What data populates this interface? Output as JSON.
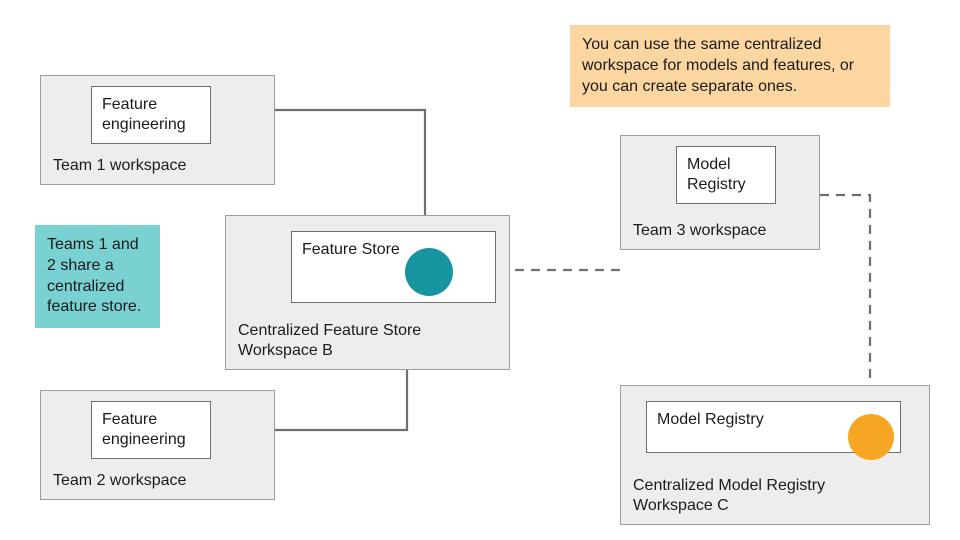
{
  "boxes": {
    "team1": {
      "label": "Team 1 workspace",
      "inner": "Feature\nengineering"
    },
    "team2": {
      "label": "Team 2 workspace",
      "inner": "Feature\nengineering"
    },
    "featureStore": {
      "label": "Centralized Feature Store\nWorkspace B",
      "inner": "Feature Store"
    },
    "team3": {
      "label": "Team 3 workspace",
      "inner": "Model\nRegistry"
    },
    "modelRegistry": {
      "label": "Centralized Model Registry\nWorkspace C",
      "inner": "Model Registry"
    }
  },
  "callouts": {
    "teal": "Teams 1 and\n2 share a\ncentralized\nfeature store.",
    "orange": "You can use the same centralized\nworkspace for models and features,\nor you can create separate ones."
  },
  "colors": {
    "boxBg": "#ededed",
    "boxBorder": "#9e9e9e",
    "innerBorder": "#6f6f6f",
    "tealCallout": "#7ad1d1",
    "orangeCallout": "#fbd6a1",
    "tealCircle": "#1894a1",
    "orangeCircle": "#f6a623",
    "arrow": "#6f6f6f"
  }
}
